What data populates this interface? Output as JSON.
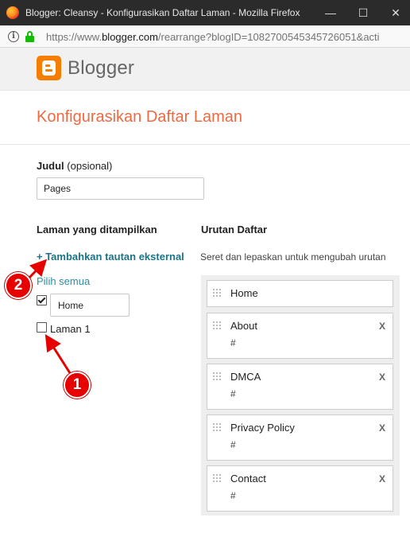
{
  "window": {
    "title": "Blogger: Cleansy - Konfigurasikan Daftar Laman - Mozilla Firefox",
    "minimize": "—",
    "maximize": "☐",
    "close": "✕"
  },
  "addressbar": {
    "url_prefix": "https://www.",
    "url_domain": "blogger.com",
    "url_rest": "/rearrange?blogID=1082700545345726051&acti"
  },
  "header": {
    "logo_text": "Blogger"
  },
  "page": {
    "title": "Konfigurasikan Daftar Laman",
    "judul_label": "Judul",
    "judul_optional": "(opsional)",
    "judul_value": "Pages",
    "left_heading": "Laman yang ditampilkan",
    "add_link": "+ Tambahkan tautan eksternal",
    "select_all": "Pilih semua",
    "pages": [
      {
        "label": "Home",
        "checked": true
      },
      {
        "label": "Laman 1",
        "checked": false
      }
    ],
    "right_heading": "Urutan Daftar",
    "order_desc": "Seret dan lepaskan untuk mengubah urutan",
    "order_items": [
      {
        "name": "Home",
        "link": "",
        "remove": ""
      },
      {
        "name": "About",
        "link": "#",
        "remove": "X"
      },
      {
        "name": "DMCA",
        "link": "#",
        "remove": "X"
      },
      {
        "name": "Privacy Policy",
        "link": "#",
        "remove": "X"
      },
      {
        "name": "Contact",
        "link": "#",
        "remove": "X"
      }
    ]
  },
  "annotations": {
    "badge_1": "1",
    "badge_2": "2",
    "color": "#e60000"
  }
}
